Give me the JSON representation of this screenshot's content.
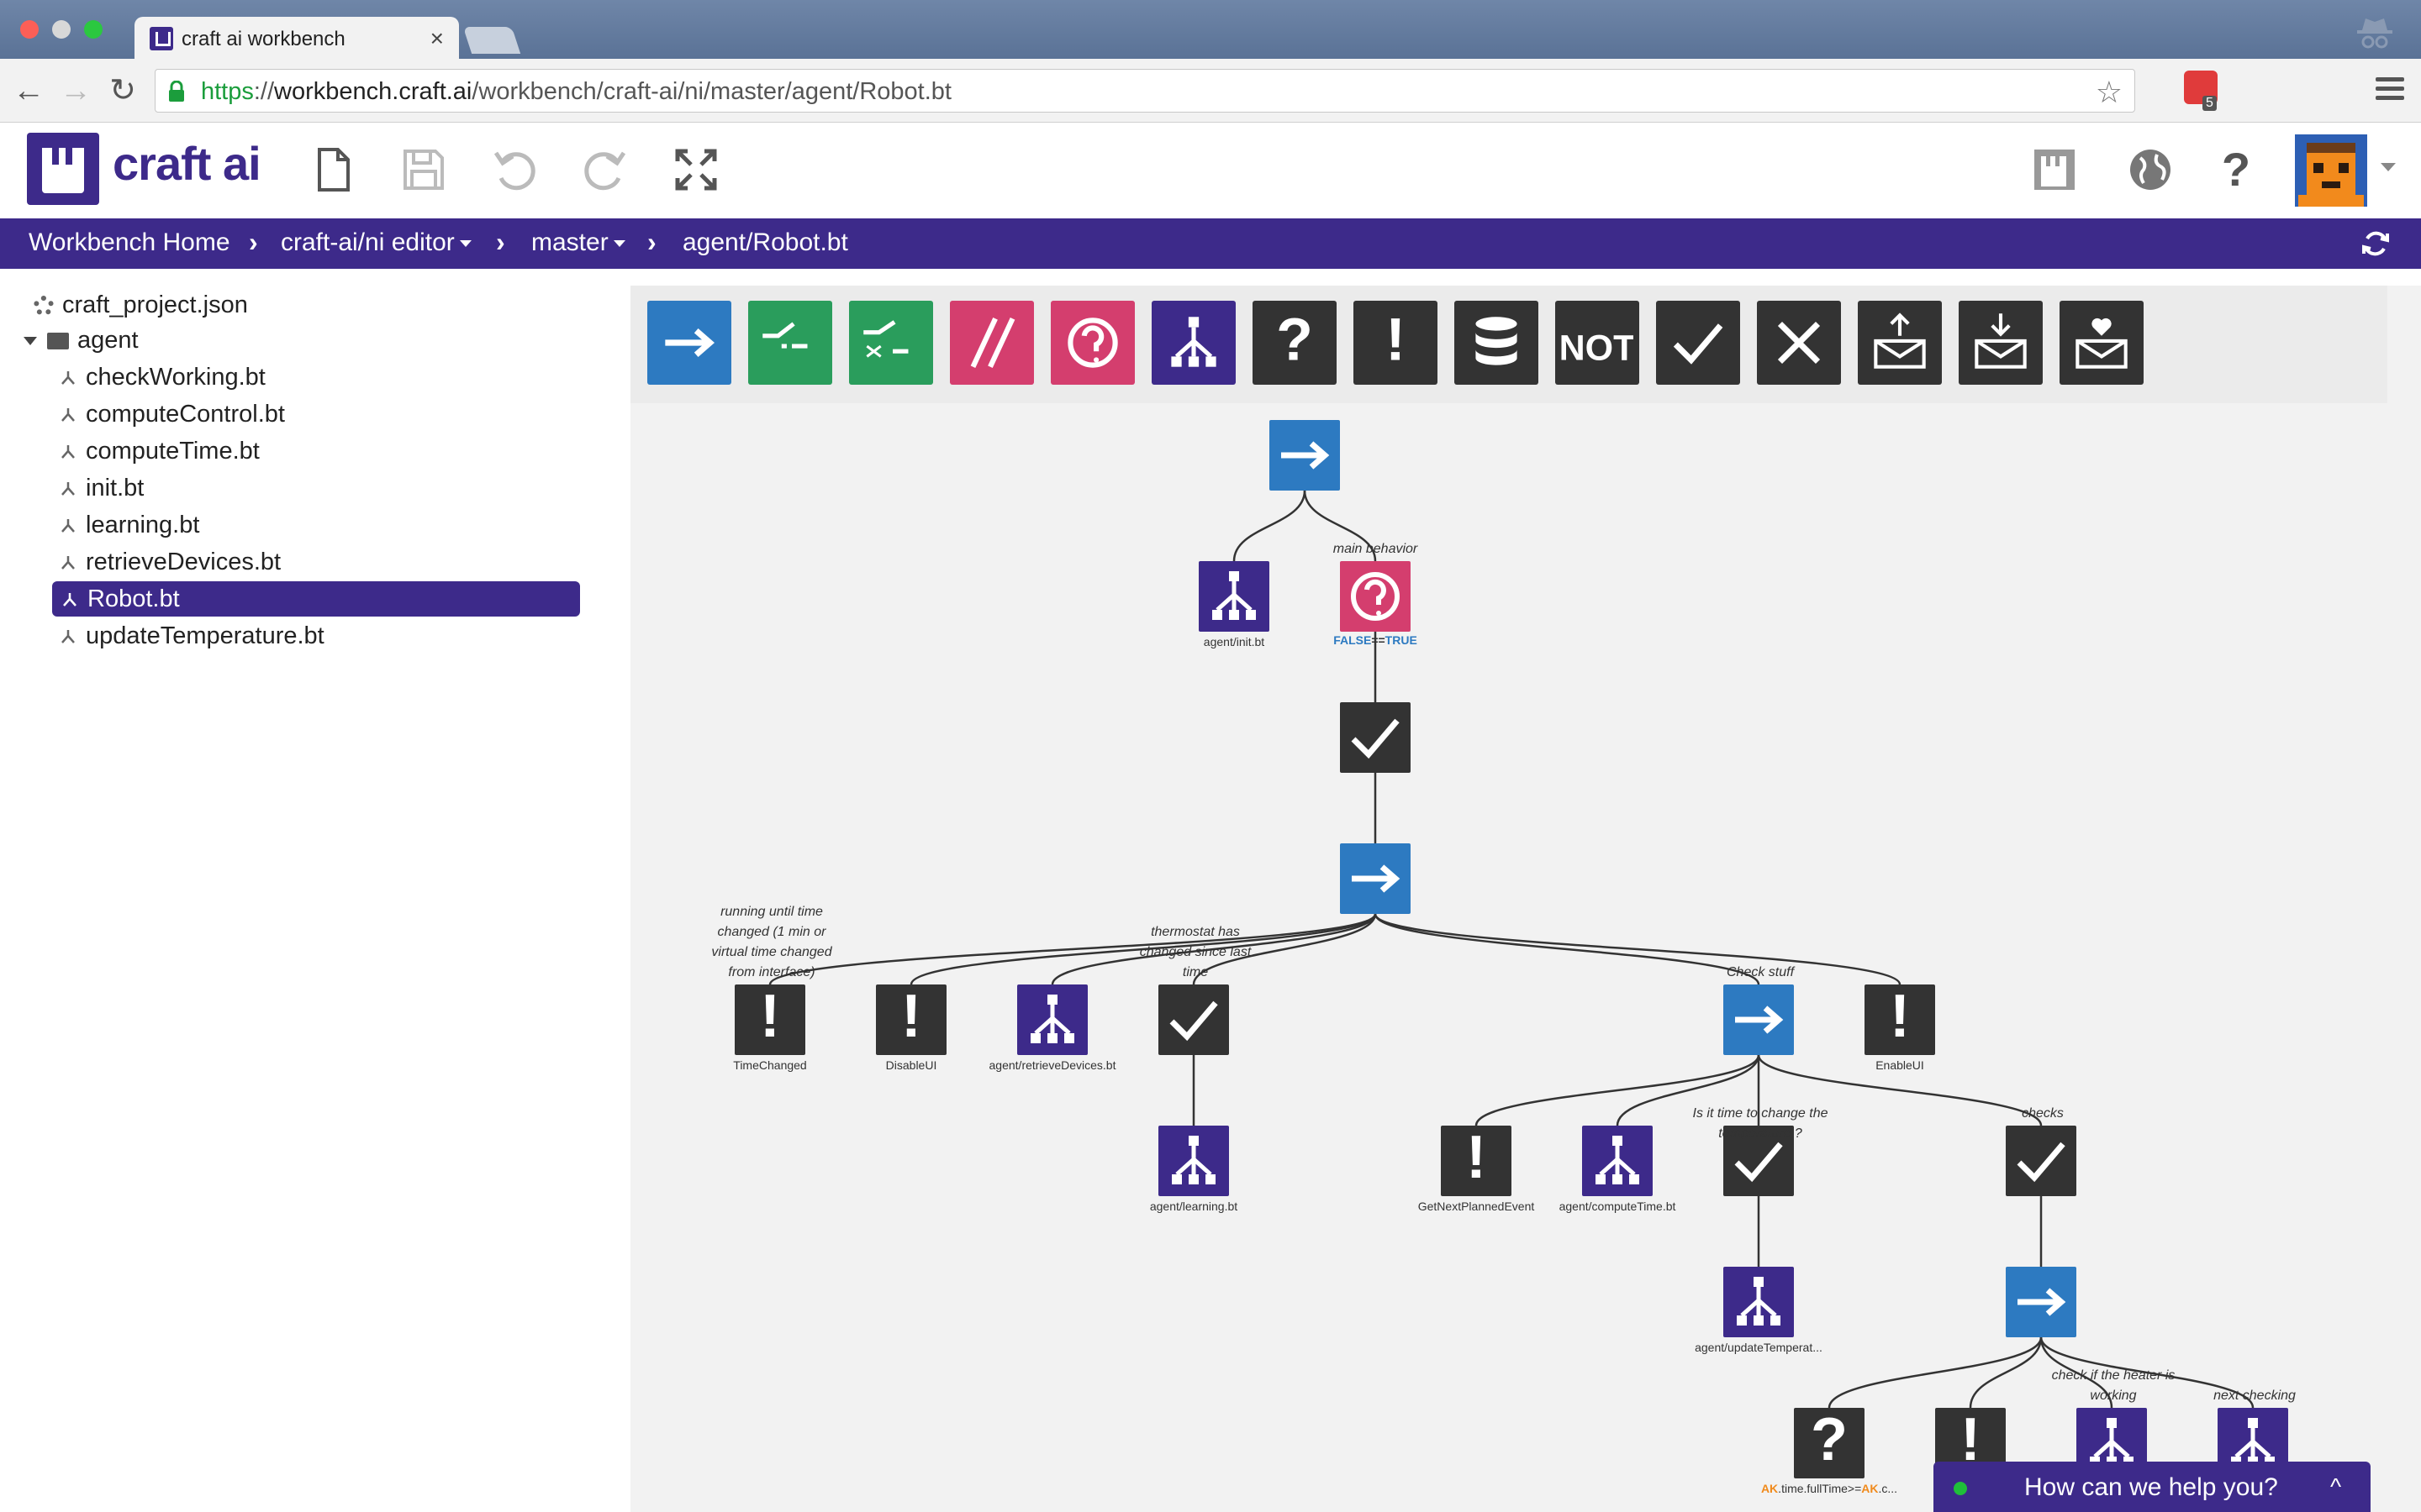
{
  "browser": {
    "tab_title": "craft ai workbench",
    "tab_close": "×",
    "url_scheme": "https",
    "url_sep": "://",
    "url_host": "workbench.craft.ai",
    "url_path": "/workbench/craft-ai/ni/master/agent/Robot.bt",
    "extension_badge": "5"
  },
  "toolbar": {
    "brand": "craft ai",
    "help_label": "?",
    "icons": [
      "new-file-icon",
      "save-icon",
      "undo-icon",
      "redo-icon",
      "fullscreen-icon",
      "craft-icon",
      "globe-icon",
      "help-icon"
    ]
  },
  "breadcrumb": {
    "items": [
      "Workbench Home",
      "craft-ai/ni editor",
      "master",
      "agent/Robot.bt"
    ],
    "separator": "›"
  },
  "sidebar": {
    "project_file": "craft_project.json",
    "folder": "agent",
    "files": [
      "checkWorking.bt",
      "computeControl.bt",
      "computeTime.bt",
      "init.bt",
      "learning.bt",
      "retrieveDevices.bt",
      "Robot.bt",
      "updateTemperature.bt"
    ],
    "selected": "Robot.bt"
  },
  "palette": {
    "items": [
      {
        "name": "sequence",
        "color": "#2d7ac1"
      },
      {
        "name": "priority",
        "color": "#2a9d5c"
      },
      {
        "name": "random",
        "color": "#2a9d5c"
      },
      {
        "name": "parallel",
        "color": "#d43e6e"
      },
      {
        "name": "while",
        "color": "#d43e6e"
      },
      {
        "name": "subtree",
        "color": "#3d2a8a"
      },
      {
        "name": "condition",
        "color": "#333333",
        "text": "?"
      },
      {
        "name": "action",
        "color": "#333333",
        "text": "!"
      },
      {
        "name": "database",
        "color": "#333333"
      },
      {
        "name": "not",
        "color": "#333333",
        "text": "NOT"
      },
      {
        "name": "success",
        "color": "#333333"
      },
      {
        "name": "failure",
        "color": "#333333"
      },
      {
        "name": "send-message",
        "color": "#333333"
      },
      {
        "name": "receive-message",
        "color": "#333333"
      },
      {
        "name": "love-message",
        "color": "#333333"
      }
    ]
  },
  "tree": {
    "labels": {
      "init": "agent/init.bt",
      "while_false": "FALSE",
      "while_eq": "==",
      "while_true": "TRUE",
      "main_behavior": "main behavior",
      "running_note_1": "running until time",
      "running_note_2": "changed (1 min or",
      "running_note_3": "virtual time changed",
      "running_note_4": "from interface)",
      "time_changed": "TimeChanged",
      "disable_ui": "DisableUI",
      "retrieve_devices": "agent/retrieveDevices.bt",
      "thermostat_note_1": "thermostat has",
      "thermostat_note_2": "changed since last",
      "thermostat_note_3": "time",
      "learning": "agent/learning.bt",
      "check_stuff": "Check stuff",
      "enable_ui": "EnableUI",
      "is_time_note_1": "Is it time to change the",
      "is_time_note_2": "temperature ?",
      "checks": "checks",
      "get_next": "GetNextPlannedEvent",
      "compute_time": "agent/computeTime.bt",
      "update_temp": "agent/updateTemperat...",
      "heater_note_1": "check if the heater is",
      "heater_note_2": "working",
      "next_checking": "next checking",
      "ak_a": "AK",
      "ak_b": ".time.fullTime>=",
      "ak_c": "AK",
      "ak_d": ".c..."
    }
  },
  "chat": {
    "label": "How can we help you?",
    "caret": "^"
  },
  "colors": {
    "brand": "#3d2a8a",
    "sequence": "#2d7ac1",
    "priority": "#2a9d5c",
    "decorator": "#d43e6e",
    "leaf": "#333333"
  }
}
